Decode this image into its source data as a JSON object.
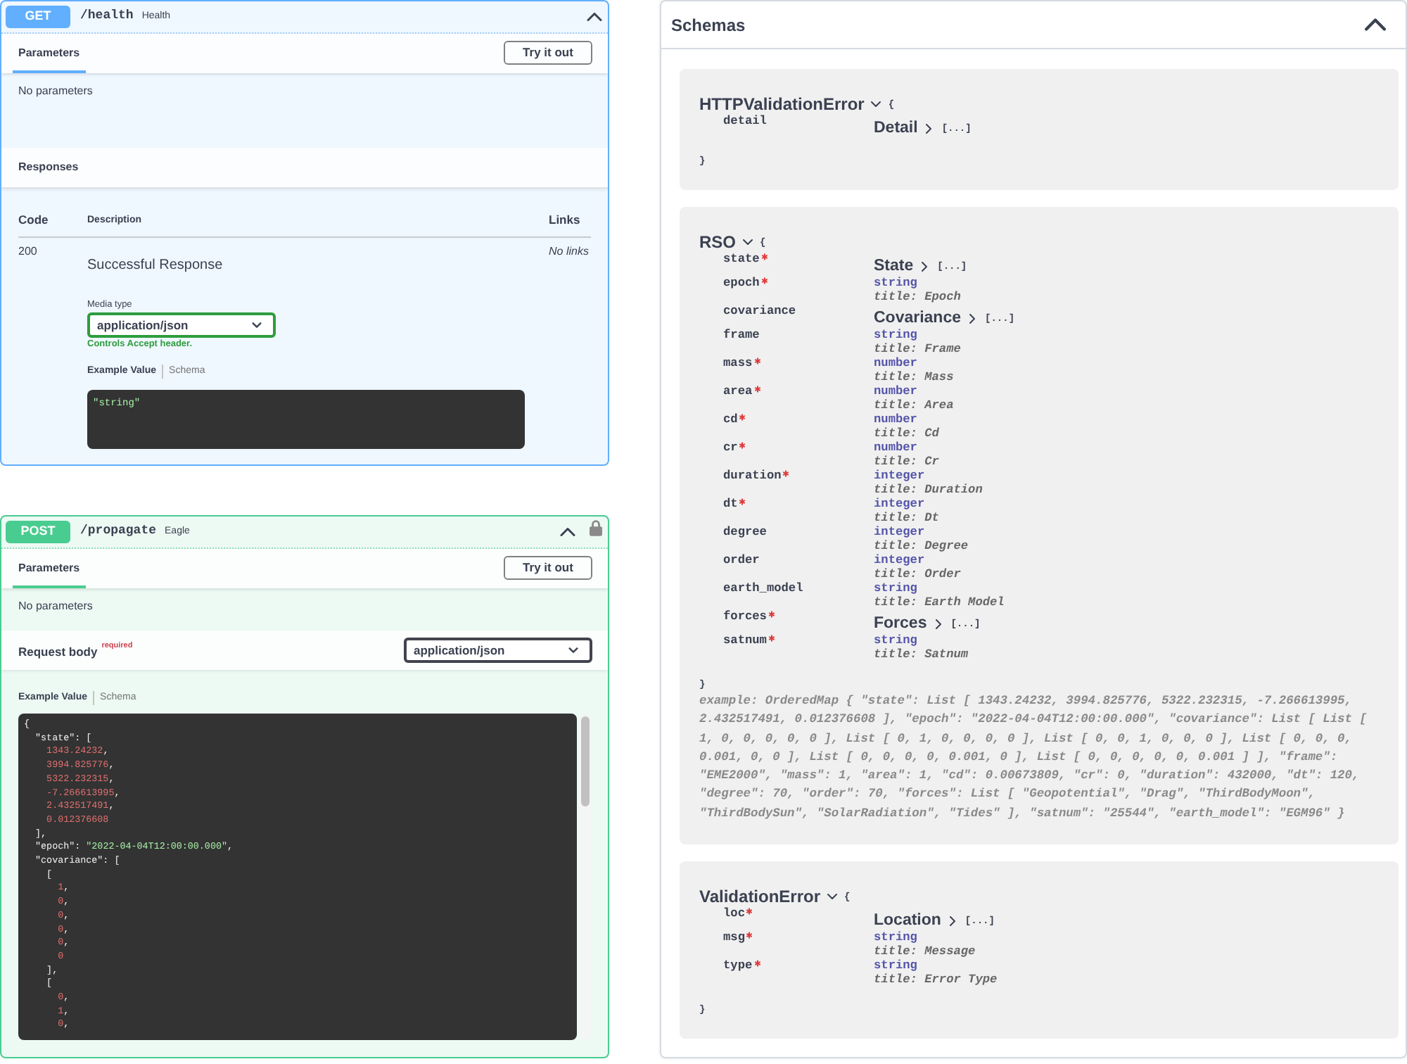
{
  "operations": [
    {
      "method": "GET",
      "color": "#61affe",
      "path": "/health",
      "summary": "Health",
      "expanded": true,
      "locked": false,
      "parameters": {
        "tabs": [
          {
            "label": "Parameters",
            "selected": true
          }
        ],
        "try_button": "Try it out",
        "empty_text": "No parameters"
      },
      "responses": {
        "title": "Responses",
        "columns": [
          "Code",
          "Description",
          "Links"
        ],
        "rows": [
          {
            "code": "200",
            "description": "Successful Response",
            "links": "No links",
            "media_type_label": "Media type",
            "media_type": "application/json",
            "media_type_hint": "Controls Accept header.",
            "example_tabs": [
              {
                "label": "Example Value",
                "selected": true
              },
              {
                "label": "Schema",
                "selected": false
              }
            ],
            "example_lines": [
              [
                {
                  "kind": "string",
                  "text": "\"string\""
                }
              ]
            ]
          }
        ]
      }
    },
    {
      "method": "POST",
      "color": "#49cc90",
      "path": "/propagate",
      "summary": "Eagle",
      "expanded": true,
      "locked": true,
      "parameters": {
        "tabs": [
          {
            "label": "Parameters",
            "selected": true
          }
        ],
        "try_button": "Try it out",
        "empty_text": "No parameters"
      },
      "request_body": {
        "label": "Request body",
        "required_label": "required",
        "media_type": "application/json",
        "example_tabs": [
          {
            "label": "Example Value",
            "selected": true
          },
          {
            "label": "Schema",
            "selected": false
          }
        ],
        "example_lines": [
          [
            {
              "kind": "punct",
              "text": "{"
            }
          ],
          [
            {
              "kind": "punct",
              "text": "  \"state\": ["
            }
          ],
          [
            {
              "kind": "number",
              "text": "    1343.24232"
            },
            {
              "kind": "punct",
              "text": ","
            }
          ],
          [
            {
              "kind": "number",
              "text": "    3994.825776"
            },
            {
              "kind": "punct",
              "text": ","
            }
          ],
          [
            {
              "kind": "number",
              "text": "    5322.232315"
            },
            {
              "kind": "punct",
              "text": ","
            }
          ],
          [
            {
              "kind": "number",
              "text": "    -7.266613995"
            },
            {
              "kind": "punct",
              "text": ","
            }
          ],
          [
            {
              "kind": "number",
              "text": "    2.432517491"
            },
            {
              "kind": "punct",
              "text": ","
            }
          ],
          [
            {
              "kind": "number",
              "text": "    0.012376608"
            }
          ],
          [
            {
              "kind": "punct",
              "text": "  ],"
            }
          ],
          [
            {
              "kind": "punct",
              "text": "  \"epoch\": "
            },
            {
              "kind": "string",
              "text": "\"2022-04-04T12:00:00.000\""
            },
            {
              "kind": "punct",
              "text": ","
            }
          ],
          [
            {
              "kind": "punct",
              "text": "  \"covariance\": ["
            }
          ],
          [
            {
              "kind": "punct",
              "text": "    ["
            }
          ],
          [
            {
              "kind": "number",
              "text": "      1"
            },
            {
              "kind": "punct",
              "text": ","
            }
          ],
          [
            {
              "kind": "number",
              "text": "      0"
            },
            {
              "kind": "punct",
              "text": ","
            }
          ],
          [
            {
              "kind": "number",
              "text": "      0"
            },
            {
              "kind": "punct",
              "text": ","
            }
          ],
          [
            {
              "kind": "number",
              "text": "      0"
            },
            {
              "kind": "punct",
              "text": ","
            }
          ],
          [
            {
              "kind": "number",
              "text": "      0"
            },
            {
              "kind": "punct",
              "text": ","
            }
          ],
          [
            {
              "kind": "number",
              "text": "      0"
            }
          ],
          [
            {
              "kind": "punct",
              "text": "    ],"
            }
          ],
          [
            {
              "kind": "punct",
              "text": "    ["
            }
          ],
          [
            {
              "kind": "number",
              "text": "      0"
            },
            {
              "kind": "punct",
              "text": ","
            }
          ],
          [
            {
              "kind": "number",
              "text": "      1"
            },
            {
              "kind": "punct",
              "text": ","
            }
          ],
          [
            {
              "kind": "number",
              "text": "      0"
            },
            {
              "kind": "punct",
              "text": ","
            }
          ]
        ]
      }
    }
  ],
  "schemas": {
    "title": "Schemas",
    "expanded": true,
    "models": [
      {
        "name": "HTTPValidationError",
        "expanded": true,
        "open_brace": "{",
        "close_brace": "}",
        "properties": [
          {
            "name": "detail",
            "required": false,
            "kind": "model",
            "model": "Detail",
            "expanded": false,
            "brief": "[...]"
          }
        ]
      },
      {
        "name": "RSO",
        "expanded": true,
        "open_brace": "{",
        "close_brace": "}",
        "properties": [
          {
            "name": "state",
            "required": true,
            "kind": "model",
            "model": "State",
            "expanded": false,
            "brief": "[...]"
          },
          {
            "name": "epoch",
            "required": true,
            "kind": "primitive",
            "type": "string",
            "title": "title: Epoch"
          },
          {
            "name": "covariance",
            "required": false,
            "kind": "model",
            "model": "Covariance",
            "expanded": false,
            "brief": "[...]"
          },
          {
            "name": "frame",
            "required": false,
            "kind": "primitive",
            "type": "string",
            "title": "title: Frame"
          },
          {
            "name": "mass",
            "required": true,
            "kind": "primitive",
            "type": "number",
            "title": "title: Mass"
          },
          {
            "name": "area",
            "required": true,
            "kind": "primitive",
            "type": "number",
            "title": "title: Area"
          },
          {
            "name": "cd",
            "required": true,
            "kind": "primitive",
            "type": "number",
            "title": "title: Cd"
          },
          {
            "name": "cr",
            "required": true,
            "kind": "primitive",
            "type": "number",
            "title": "title: Cr"
          },
          {
            "name": "duration",
            "required": true,
            "kind": "primitive",
            "type": "integer",
            "title": "title: Duration"
          },
          {
            "name": "dt",
            "required": true,
            "kind": "primitive",
            "type": "integer",
            "title": "title: Dt"
          },
          {
            "name": "degree",
            "required": false,
            "kind": "primitive",
            "type": "integer",
            "title": "title: Degree"
          },
          {
            "name": "order",
            "required": false,
            "kind": "primitive",
            "type": "integer",
            "title": "title: Order"
          },
          {
            "name": "earth_model",
            "required": false,
            "kind": "primitive",
            "type": "string",
            "title": "title: Earth Model"
          },
          {
            "name": "forces",
            "required": true,
            "kind": "model",
            "model": "Forces",
            "expanded": false,
            "brief": "[...]"
          },
          {
            "name": "satnum",
            "required": true,
            "kind": "primitive",
            "type": "string",
            "title": "title: Satnum"
          }
        ],
        "example": "example: OrderedMap { \"state\": List [ 1343.24232, 3994.825776, 5322.232315, -7.266613995, 2.432517491, 0.012376608 ], \"epoch\": \"2022-04-04T12:00:00.000\", \"covariance\": List [ List [ 1, 0, 0, 0, 0, 0 ], List [ 0, 1, 0, 0, 0, 0 ], List [ 0, 0, 1, 0, 0, 0 ], List [ 0, 0, 0, 0.001, 0, 0 ], List [ 0, 0, 0, 0, 0.001, 0 ], List [ 0, 0, 0, 0, 0, 0.001 ] ], \"frame\": \"EME2000\", \"mass\": 1, \"area\": 1, \"cd\": 0.00673809, \"cr\": 0, \"duration\": 432000, \"dt\": 120, \"degree\": 70, \"order\": 70, \"forces\": List [ \"Geopotential\", \"Drag\", \"ThirdBodyMoon\", \"ThirdBodySun\", \"SolarRadiation\", \"Tides\" ], \"satnum\": \"25544\", \"earth_model\": \"EGM96\" }"
      },
      {
        "name": "ValidationError",
        "expanded": true,
        "open_brace": "{",
        "close_brace": "}",
        "properties": [
          {
            "name": "loc",
            "required": true,
            "kind": "model",
            "model": "Location",
            "expanded": false,
            "brief": "[...]"
          },
          {
            "name": "msg",
            "required": true,
            "kind": "primitive",
            "type": "string",
            "title": "title: Message"
          },
          {
            "name": "type",
            "required": true,
            "kind": "primitive",
            "type": "string",
            "title": "title: Error Type"
          }
        ]
      }
    ]
  }
}
